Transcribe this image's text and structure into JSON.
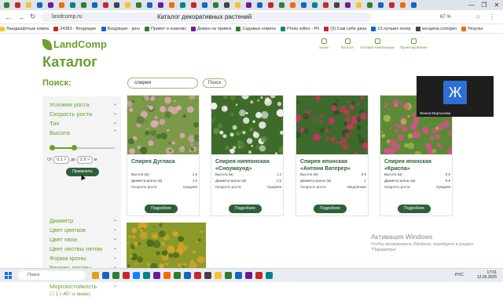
{
  "browser": {
    "url": "landcomp.ru",
    "page_title": "Каталог декоративных растений",
    "zoom": "67 %",
    "window_controls": [
      "—",
      "❐",
      "✕"
    ],
    "tab_colors": [
      "#2e7d32",
      "#c62828",
      "#fbc02d",
      "#1565c0",
      "#6a1b9a",
      "#ef6c00",
      "#00838f",
      "#2e7d32",
      "#1565c0",
      "#c62828",
      "#424242",
      "#fbc02d",
      "#2e7d32",
      "#1565c0",
      "#6a1b9a",
      "#ef6c00",
      "#00838f",
      "#c62828",
      "#1565c0",
      "#2e7d32",
      "#424242",
      "#fbc02d",
      "#6a1b9a",
      "#1565c0",
      "#c62828",
      "#2e7d32",
      "#ef6c00",
      "#1565c0",
      "#00838f",
      "#c62828",
      "#424242",
      "#6a1b9a",
      "#fbc02d",
      "#2e7d32",
      "#1565c0",
      "#c62828",
      "#ef6c00",
      "#1565c0"
    ],
    "bookmarks": [
      {
        "label": "Ландшафтные компа",
        "color": "#fbc02d"
      },
      {
        "label": "24383 - Входящие",
        "color": "#c62828"
      },
      {
        "label": "Входящие - janu",
        "color": "#1565c0"
      },
      {
        "label": "Привет и знакомс",
        "color": "#2e7d32"
      },
      {
        "label": "Домен не привяз",
        "color": "#6a1b9a"
      },
      {
        "label": "Садовые композ",
        "color": "#2e7d32"
      },
      {
        "label": "Photo editor - Ph",
        "color": "#00838f"
      },
      {
        "label": "(3) Сам себе диза",
        "color": "#c62828"
      },
      {
        "label": "13 лучших генер",
        "color": "#1565c0"
      },
      {
        "label": "secapeai.com/gen",
        "color": "#424242"
      },
      {
        "label": "Результ",
        "color": "#ef6c00"
      }
    ]
  },
  "site": {
    "logo_text": "LandComp",
    "nav": [
      {
        "label": "Уроки",
        "icon": "lessons-icon"
      },
      {
        "label": "Каталог",
        "icon": "catalog-icon"
      },
      {
        "label": "Готовые композиции",
        "icon": "compositions-icon"
      },
      {
        "label": "Проектирование",
        "icon": "design-icon"
      }
    ],
    "heading": "Каталог",
    "search_label": "Поиск:",
    "search_value": "спирея",
    "search_button": "Поиск"
  },
  "filters": {
    "top": [
      "Условия роста",
      "Скорость роста",
      "Тип",
      "Высота"
    ],
    "height_from_label": "От",
    "height_from": "0.1",
    "height_to_label": "до",
    "height_to": "2.9",
    "height_unit": "м",
    "clear_symbol": "✕",
    "slider_min_fraction": 0.0,
    "slider_max_fraction": 0.35,
    "apply_button": "Применить",
    "bottom": [
      "Диаметр",
      "Цвет цветков",
      "Цвет хвои",
      "Цвет листвы летом",
      "Форма кроны",
      "Размер листвы",
      "Время цветения",
      "Морозостойкость"
    ],
    "frost_option": "1 (-45° и ниже)"
  },
  "products": [
    {
      "title": "Спирея Дугласа",
      "specs": [
        {
          "k": "Высота (м)",
          "v": "1.5"
        },
        {
          "k": "Диаметр кроны (м)",
          "v": "1.5"
        },
        {
          "k": "Скорость роста",
          "v": "Средняя"
        }
      ],
      "more": "Подробнее",
      "photo": [
        "#7a9a4a",
        "#e7a7b9",
        "#4c6e2c"
      ]
    },
    {
      "title": "Спирея ниппонская «Сноумаунд»",
      "specs": [
        {
          "k": "Высота (м)",
          "v": "1.2"
        },
        {
          "k": "Диаметр кроны (м)",
          "v": "1.5"
        },
        {
          "k": "Скорость роста",
          "v": "Средняя"
        }
      ],
      "more": "Подробнее",
      "photo": [
        "#3e6b2a",
        "#f4f4ee",
        "#5f8c3e"
      ]
    },
    {
      "title": "Спирея японская «Антони Ватерер»",
      "specs": [
        {
          "k": "Высота (м)",
          "v": "0.8"
        },
        {
          "k": "Диаметр кроны (м)",
          "v": "1"
        },
        {
          "k": "Скорость роста",
          "v": "Медленная"
        }
      ],
      "more": "Подробнее",
      "photo": [
        "#3f6a2d",
        "#c8365b",
        "#2f4f22"
      ]
    },
    {
      "title": "Спирея японская «Криспа»",
      "specs": [
        {
          "k": "Высота (м)",
          "v": "0.6"
        },
        {
          "k": "Диаметр кроны (м)",
          "v": "0.8"
        },
        {
          "k": "Скорость роста",
          "v": "Средняя"
        }
      ],
      "more": "Подробнее",
      "photo": [
        "#5b8a36",
        "#d8508a",
        "#aab84a"
      ]
    }
  ],
  "partial_card_photo": [
    "#8a9a2a",
    "#d9a32a",
    "#4d6b1e"
  ],
  "video": {
    "avatar_letter": "Ж",
    "name": "Жанна Мартынова"
  },
  "watermark": {
    "title": "Активация Windows",
    "text": "Чтобы активировать Windows, перейдите в раздел \"Параметры\"."
  },
  "taskbar": {
    "search_placeholder": "Поиск",
    "lang": "РУС",
    "time": "17:01",
    "date": "12.05.2025",
    "app_colors": [
      "#e0a21a",
      "#1565c0",
      "#2e7d32",
      "#c62828",
      "#0a84ff",
      "#00838f",
      "#6a1b9a",
      "#ef6c00",
      "#2e7d32",
      "#1565c0",
      "#c62828",
      "#424242",
      "#fbc02d",
      "#2e7d32",
      "#1565c0",
      "#6a1b9a",
      "#c62828",
      "#00838f"
    ]
  }
}
